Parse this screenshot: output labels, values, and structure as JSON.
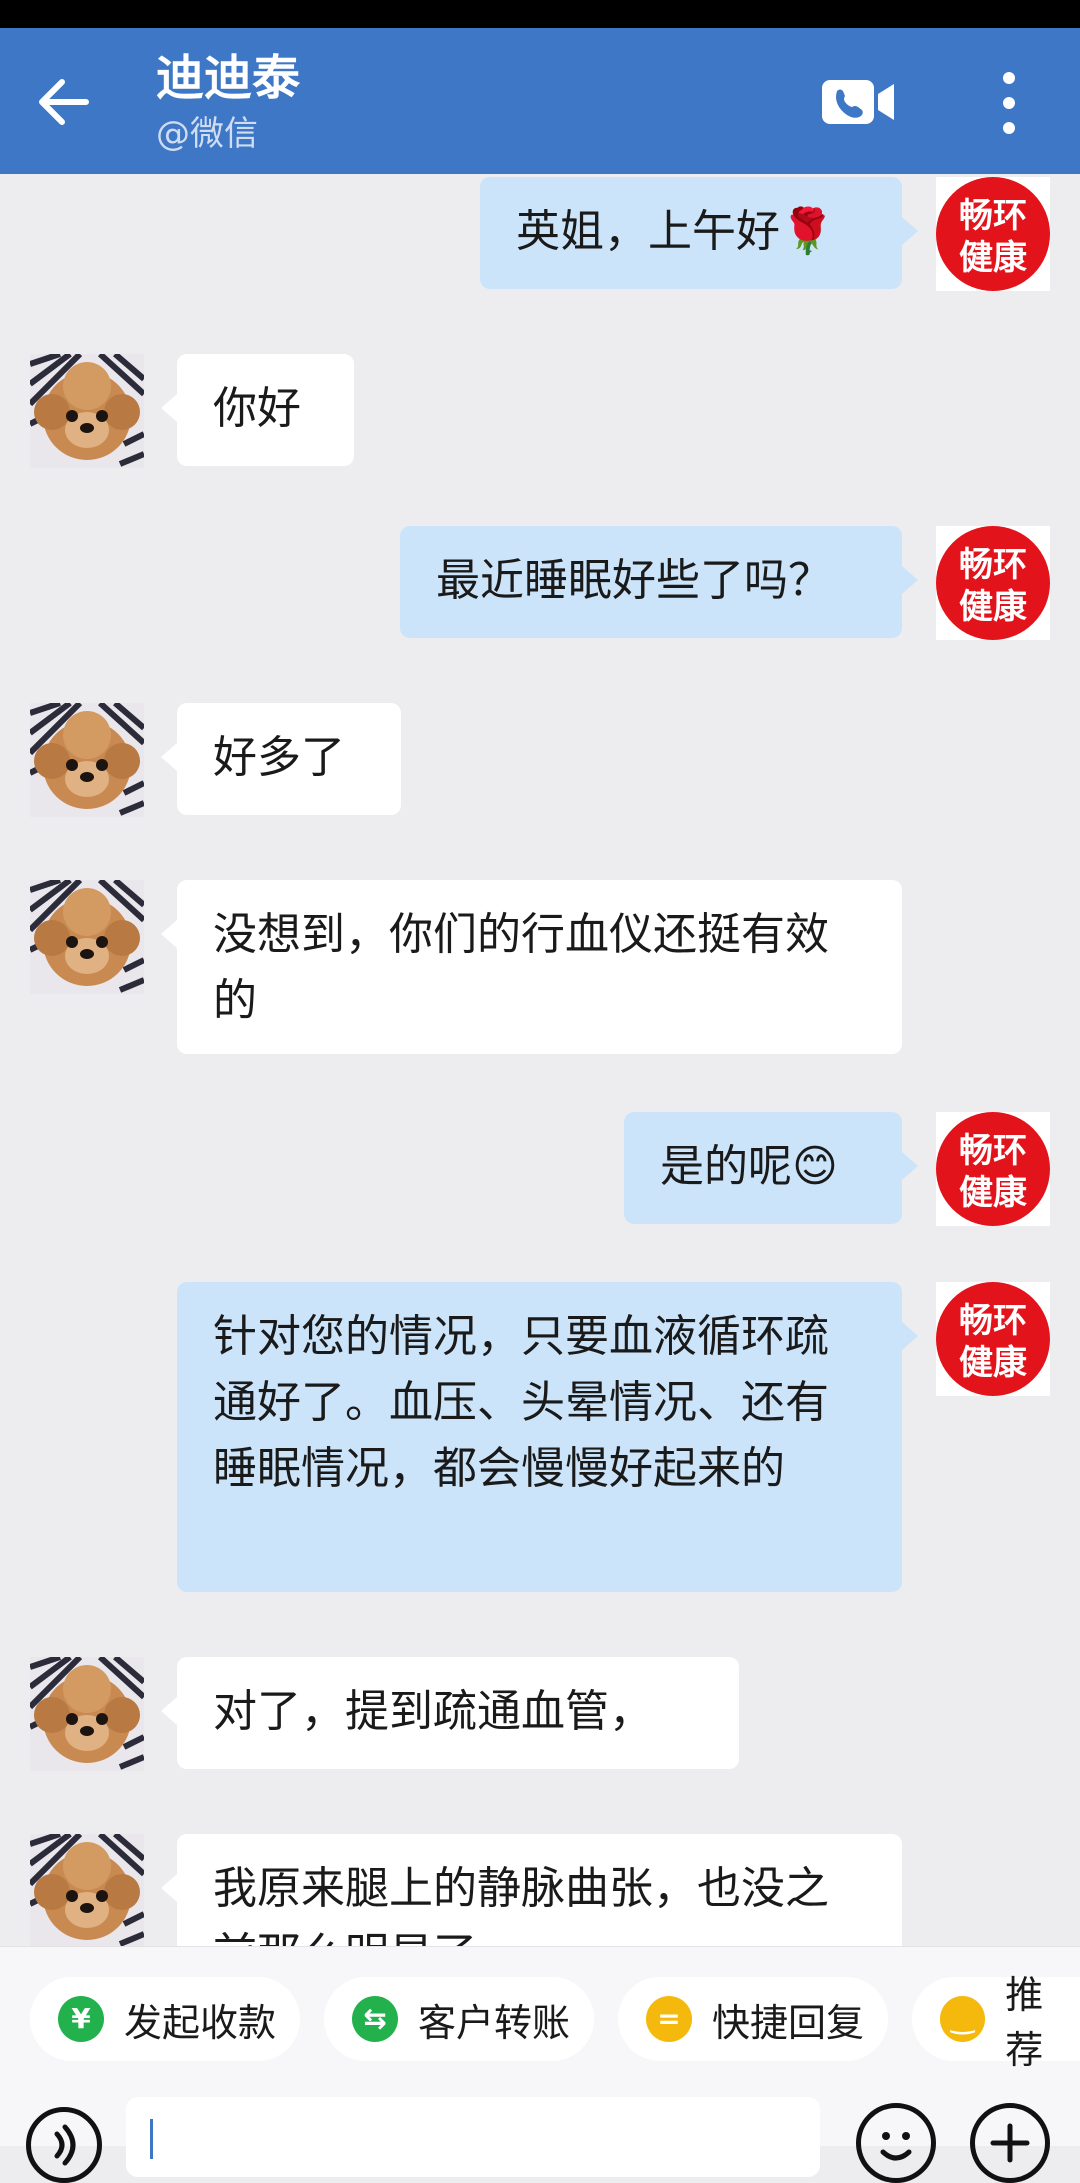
{
  "header": {
    "contact_name": "迪迪泰",
    "contact_sub": "@微信",
    "back_icon": "arrow-left-icon",
    "video_icon": "video-call-icon",
    "more_icon": "more-vertical-icon"
  },
  "agent_avatar": {
    "line1": "畅环",
    "line2": "健康",
    "color": "#e3131b"
  },
  "messages": [
    {
      "side": "out",
      "text": "英姐，上午好🌹"
    },
    {
      "side": "in",
      "text": "你好"
    },
    {
      "side": "out",
      "text": "最近睡眠好些了吗？"
    },
    {
      "side": "in",
      "text": "好多了"
    },
    {
      "side": "in",
      "text": "没想到，你们的行血仪还挺有效的"
    },
    {
      "side": "out",
      "text": "是的呢😊"
    },
    {
      "side": "out",
      "text": "针对您的情况，只要血液循环疏通好了。血压、头晕情况、还有睡眠情况，都会慢慢好起来的"
    },
    {
      "side": "in",
      "text": "对了，提到疏通血管，"
    },
    {
      "side": "in",
      "text": "我原来腿上的静脉曲张，也没之前那么明显了"
    }
  ],
  "quick_actions": [
    {
      "label": "发起收款",
      "icon": "yuan-shield-icon",
      "glyph": "¥",
      "color": "#22b14c"
    },
    {
      "label": "客户转账",
      "icon": "transfer-icon",
      "glyph": "⇆",
      "color": "#22b14c"
    },
    {
      "label": "快捷回复",
      "icon": "quick-reply-icon",
      "glyph": "=",
      "color": "#f5b80c"
    },
    {
      "label": "推荐",
      "icon": "recommend-icon",
      "glyph": "‿",
      "color": "#f5b80c"
    }
  ],
  "input": {
    "placeholder": ""
  }
}
